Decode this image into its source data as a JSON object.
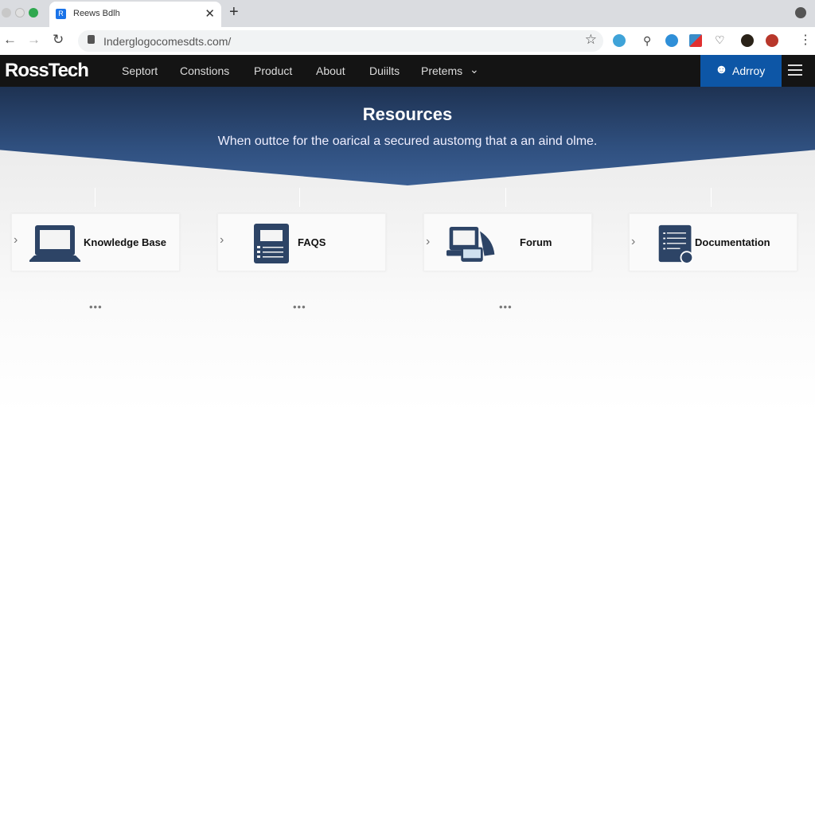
{
  "browser": {
    "tab_title": "Reews Bdlh",
    "url": "Inderglogocomesdts.com/",
    "colors": {
      "close": "#c8c8c8",
      "min": "#d6d6d6",
      "max": "#2fa84f"
    }
  },
  "nav": {
    "logo": "RossTech",
    "items": [
      "Septort",
      "Constions",
      "Product",
      "About",
      "Duiilts",
      "Pretems"
    ],
    "admin_label": "Adrroy",
    "accent": "#0d56a6"
  },
  "hero": {
    "title": "Resources",
    "subtitle": "When outtce for the oarical a secured austomg that a an aind olme."
  },
  "cards": [
    {
      "label": "Knowledge Base",
      "icon": "laptop-icon"
    },
    {
      "label": "FAQS",
      "icon": "faq-document-icon"
    },
    {
      "label": "Forum",
      "icon": "devices-icon"
    },
    {
      "label": "Documentation",
      "icon": "documentation-icon"
    }
  ],
  "more_label": "•••"
}
